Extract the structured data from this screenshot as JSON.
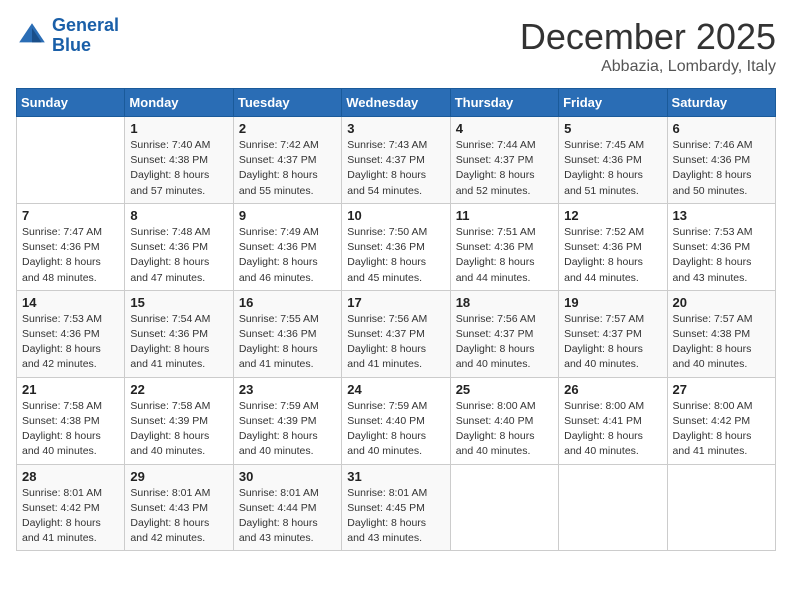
{
  "logo": {
    "line1": "General",
    "line2": "Blue"
  },
  "title": "December 2025",
  "subtitle": "Abbazia, Lombardy, Italy",
  "days_header": [
    "Sunday",
    "Monday",
    "Tuesday",
    "Wednesday",
    "Thursday",
    "Friday",
    "Saturday"
  ],
  "weeks": [
    [
      {
        "num": "",
        "info": ""
      },
      {
        "num": "1",
        "info": "Sunrise: 7:40 AM\nSunset: 4:38 PM\nDaylight: 8 hours\nand 57 minutes."
      },
      {
        "num": "2",
        "info": "Sunrise: 7:42 AM\nSunset: 4:37 PM\nDaylight: 8 hours\nand 55 minutes."
      },
      {
        "num": "3",
        "info": "Sunrise: 7:43 AM\nSunset: 4:37 PM\nDaylight: 8 hours\nand 54 minutes."
      },
      {
        "num": "4",
        "info": "Sunrise: 7:44 AM\nSunset: 4:37 PM\nDaylight: 8 hours\nand 52 minutes."
      },
      {
        "num": "5",
        "info": "Sunrise: 7:45 AM\nSunset: 4:36 PM\nDaylight: 8 hours\nand 51 minutes."
      },
      {
        "num": "6",
        "info": "Sunrise: 7:46 AM\nSunset: 4:36 PM\nDaylight: 8 hours\nand 50 minutes."
      }
    ],
    [
      {
        "num": "7",
        "info": "Sunrise: 7:47 AM\nSunset: 4:36 PM\nDaylight: 8 hours\nand 48 minutes."
      },
      {
        "num": "8",
        "info": "Sunrise: 7:48 AM\nSunset: 4:36 PM\nDaylight: 8 hours\nand 47 minutes."
      },
      {
        "num": "9",
        "info": "Sunrise: 7:49 AM\nSunset: 4:36 PM\nDaylight: 8 hours\nand 46 minutes."
      },
      {
        "num": "10",
        "info": "Sunrise: 7:50 AM\nSunset: 4:36 PM\nDaylight: 8 hours\nand 45 minutes."
      },
      {
        "num": "11",
        "info": "Sunrise: 7:51 AM\nSunset: 4:36 PM\nDaylight: 8 hours\nand 44 minutes."
      },
      {
        "num": "12",
        "info": "Sunrise: 7:52 AM\nSunset: 4:36 PM\nDaylight: 8 hours\nand 44 minutes."
      },
      {
        "num": "13",
        "info": "Sunrise: 7:53 AM\nSunset: 4:36 PM\nDaylight: 8 hours\nand 43 minutes."
      }
    ],
    [
      {
        "num": "14",
        "info": "Sunrise: 7:53 AM\nSunset: 4:36 PM\nDaylight: 8 hours\nand 42 minutes."
      },
      {
        "num": "15",
        "info": "Sunrise: 7:54 AM\nSunset: 4:36 PM\nDaylight: 8 hours\nand 41 minutes."
      },
      {
        "num": "16",
        "info": "Sunrise: 7:55 AM\nSunset: 4:36 PM\nDaylight: 8 hours\nand 41 minutes."
      },
      {
        "num": "17",
        "info": "Sunrise: 7:56 AM\nSunset: 4:37 PM\nDaylight: 8 hours\nand 41 minutes."
      },
      {
        "num": "18",
        "info": "Sunrise: 7:56 AM\nSunset: 4:37 PM\nDaylight: 8 hours\nand 40 minutes."
      },
      {
        "num": "19",
        "info": "Sunrise: 7:57 AM\nSunset: 4:37 PM\nDaylight: 8 hours\nand 40 minutes."
      },
      {
        "num": "20",
        "info": "Sunrise: 7:57 AM\nSunset: 4:38 PM\nDaylight: 8 hours\nand 40 minutes."
      }
    ],
    [
      {
        "num": "21",
        "info": "Sunrise: 7:58 AM\nSunset: 4:38 PM\nDaylight: 8 hours\nand 40 minutes."
      },
      {
        "num": "22",
        "info": "Sunrise: 7:58 AM\nSunset: 4:39 PM\nDaylight: 8 hours\nand 40 minutes."
      },
      {
        "num": "23",
        "info": "Sunrise: 7:59 AM\nSunset: 4:39 PM\nDaylight: 8 hours\nand 40 minutes."
      },
      {
        "num": "24",
        "info": "Sunrise: 7:59 AM\nSunset: 4:40 PM\nDaylight: 8 hours\nand 40 minutes."
      },
      {
        "num": "25",
        "info": "Sunrise: 8:00 AM\nSunset: 4:40 PM\nDaylight: 8 hours\nand 40 minutes."
      },
      {
        "num": "26",
        "info": "Sunrise: 8:00 AM\nSunset: 4:41 PM\nDaylight: 8 hours\nand 40 minutes."
      },
      {
        "num": "27",
        "info": "Sunrise: 8:00 AM\nSunset: 4:42 PM\nDaylight: 8 hours\nand 41 minutes."
      }
    ],
    [
      {
        "num": "28",
        "info": "Sunrise: 8:01 AM\nSunset: 4:42 PM\nDaylight: 8 hours\nand 41 minutes."
      },
      {
        "num": "29",
        "info": "Sunrise: 8:01 AM\nSunset: 4:43 PM\nDaylight: 8 hours\nand 42 minutes."
      },
      {
        "num": "30",
        "info": "Sunrise: 8:01 AM\nSunset: 4:44 PM\nDaylight: 8 hours\nand 43 minutes."
      },
      {
        "num": "31",
        "info": "Sunrise: 8:01 AM\nSunset: 4:45 PM\nDaylight: 8 hours\nand 43 minutes."
      },
      {
        "num": "",
        "info": ""
      },
      {
        "num": "",
        "info": ""
      },
      {
        "num": "",
        "info": ""
      }
    ]
  ]
}
